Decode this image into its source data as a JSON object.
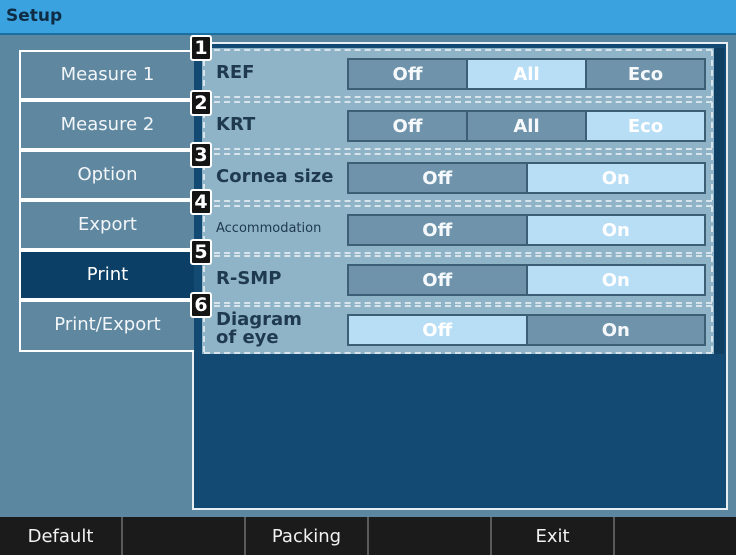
{
  "title": "Setup",
  "sidebar": {
    "tabs": [
      {
        "label": "Measure 1"
      },
      {
        "label": "Measure 2"
      },
      {
        "label": "Option"
      },
      {
        "label": "Export"
      },
      {
        "label": "Print",
        "active": true
      },
      {
        "label": "Print/Export"
      }
    ]
  },
  "settings": [
    {
      "number": "1",
      "label": "REF",
      "options": [
        "Off",
        "All",
        "Eco"
      ],
      "selected": "All"
    },
    {
      "number": "2",
      "label": "KRT",
      "options": [
        "Off",
        "All",
        "Eco"
      ],
      "selected": "Eco"
    },
    {
      "number": "3",
      "label": "Cornea size",
      "options": [
        "Off",
        "On"
      ],
      "selected": "On"
    },
    {
      "number": "4",
      "label": "Accommodation",
      "options": [
        "Off",
        "On"
      ],
      "selected": "On"
    },
    {
      "number": "5",
      "label": "R-SMP",
      "options": [
        "Off",
        "On"
      ],
      "selected": "On"
    },
    {
      "number": "6",
      "label": "Diagram of eye",
      "options": [
        "Off",
        "On"
      ],
      "selected": "Off"
    }
  ],
  "footer": {
    "keys": [
      "Default",
      "",
      "Packing",
      "",
      "Exit",
      ""
    ]
  },
  "colors": {
    "title_bar": "#3aa2df",
    "selected_option": "#b8def5",
    "active_tab": "#0b3f66",
    "panel": "#124a73"
  }
}
